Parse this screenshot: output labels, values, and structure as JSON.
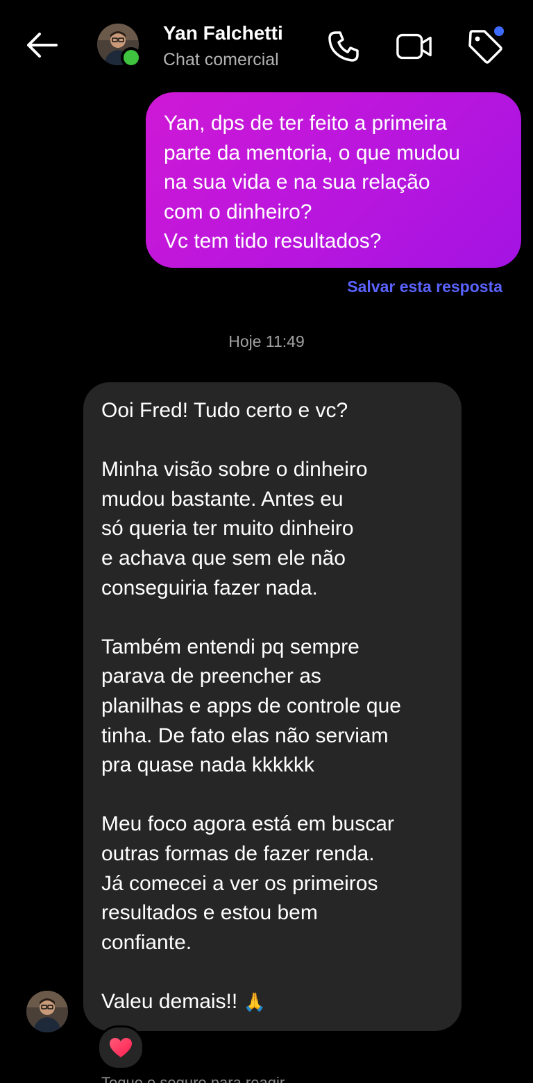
{
  "header": {
    "contact_name": "Yan Falchetti",
    "subtitle": "Chat comercial",
    "icons": [
      "back-arrow-icon",
      "phone-icon",
      "video-camera-icon",
      "tag-icon"
    ],
    "online_status_color": "#3ec43e",
    "tag_badge_color": "#3d6bff"
  },
  "sent_message": {
    "lines": [
      "Yan, dps de ter feito a primeira",
      "parte da mentoria, o que mudou",
      "na sua vida e na sua relação",
      "com o dinheiro?",
      "Vc tem tido resultados?"
    ],
    "bubble_color": "#b616de"
  },
  "save_reply_label": "Salvar esta resposta",
  "timestamp": "Hoje 11:49",
  "received_message": {
    "lines": [
      "Ooi Fred! Tudo certo e vc?",
      "",
      "Minha visão sobre o dinheiro",
      "mudou bastante. Antes eu",
      "só queria ter muito dinheiro",
      "e achava que sem ele não",
      "conseguiria fazer nada.",
      "",
      "Também entendi pq sempre",
      "parava de preencher as",
      "planilhas e apps de controle que",
      "tinha. De fato elas não serviam",
      "pra quase nada kkkkkk",
      "",
      "Meu foco agora está em buscar",
      "outras formas de fazer renda.",
      "Já comecei a ver os primeiros",
      "resultados e estou bem",
      "confiante.",
      "",
      "Valeu demais!!"
    ],
    "emoji": "🙏",
    "bubble_color": "#262626"
  },
  "reaction": {
    "emoji": "heart-icon",
    "color": "#ff2d55"
  },
  "cutoff_text": "Toque e segure para reagir"
}
